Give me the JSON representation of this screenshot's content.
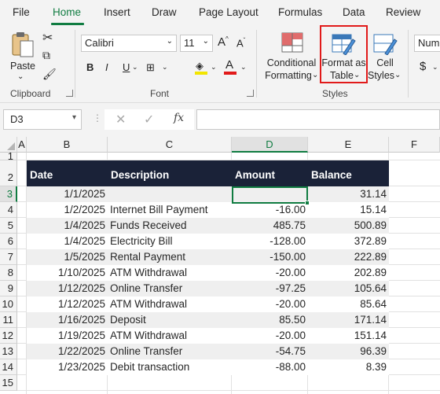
{
  "menu": {
    "tabs": [
      "File",
      "Home",
      "Insert",
      "Draw",
      "Page Layout",
      "Formulas",
      "Data",
      "Review"
    ],
    "active": "Home"
  },
  "ribbon": {
    "clipboard": {
      "paste_label": "Paste",
      "group_label": "Clipboard"
    },
    "font": {
      "font_name": "Calibri",
      "font_size": "11",
      "bold": "B",
      "italic": "I",
      "underline": "U",
      "group_label": "Font"
    },
    "styles": {
      "conditional_line1": "Conditional",
      "conditional_line2": "Formatting",
      "format_table_line1": "Format as",
      "format_table_line2": "Table",
      "cell_styles_line1": "Cell",
      "cell_styles_line2": "Styles",
      "group_label": "Styles"
    },
    "number": {
      "format": "Num",
      "currency": "$"
    }
  },
  "formula_bar": {
    "name_box": "D3",
    "fx": "fx",
    "formula": ""
  },
  "grid": {
    "columns": [
      "A",
      "B",
      "C",
      "D",
      "E",
      "F"
    ],
    "selected_column": "D",
    "rows": [
      "1",
      "2",
      "3",
      "4",
      "5",
      "6",
      "7",
      "8",
      "9",
      "10",
      "11",
      "12",
      "13",
      "14",
      "15"
    ],
    "selected_row": "3",
    "table": {
      "headers": [
        "Date",
        "Description",
        "Amount",
        "Balance"
      ],
      "rows": [
        [
          "1/1/2025",
          "",
          "",
          "31.14"
        ],
        [
          "1/2/2025",
          "Internet Bill Payment",
          "-16.00",
          "15.14"
        ],
        [
          "1/4/2025",
          "Funds Received",
          "485.75",
          "500.89"
        ],
        [
          "1/4/2025",
          "Electricity Bill",
          "-128.00",
          "372.89"
        ],
        [
          "1/5/2025",
          "Rental Payment",
          "-150.00",
          "222.89"
        ],
        [
          "1/10/2025",
          "ATM Withdrawal",
          "-20.00",
          "202.89"
        ],
        [
          "1/12/2025",
          "Online Transfer",
          "-97.25",
          "105.64"
        ],
        [
          "1/12/2025",
          "ATM Withdrawal",
          "-20.00",
          "85.64"
        ],
        [
          "1/16/2025",
          "Deposit",
          "85.50",
          "171.14"
        ],
        [
          "1/19/2025",
          "ATM Withdrawal",
          "-20.00",
          "151.14"
        ],
        [
          "1/22/2025",
          "Online Transfer",
          "-54.75",
          "96.39"
        ],
        [
          "1/23/2025",
          "Debit transaction",
          "-88.00",
          "8.39"
        ]
      ]
    }
  },
  "colors": {
    "accent": "#107c41",
    "table_header": "#1a2238",
    "band": "#efefef",
    "highlight": "#e11a1a"
  }
}
